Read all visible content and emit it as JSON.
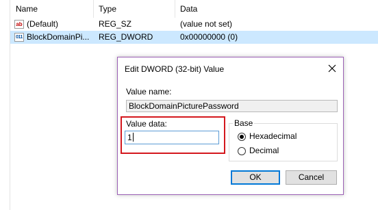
{
  "columns": {
    "name": "Name",
    "type": "Type",
    "data": "Data"
  },
  "rows": [
    {
      "icon": "string-value-icon",
      "icon_glyph": "ab",
      "name": "(Default)",
      "type": "REG_SZ",
      "data": "(value not set)"
    },
    {
      "icon": "binary-value-icon",
      "icon_glyph": "011",
      "name": "BlockDomainPi...",
      "type": "REG_DWORD",
      "data": "0x00000000 (0)"
    }
  ],
  "dialog": {
    "title": "Edit DWORD (32-bit) Value",
    "close_label": "close-icon",
    "value_name_label": "Value name:",
    "value_name": "BlockDomainPicturePassword",
    "value_data_label": "Value data:",
    "value_data": "1",
    "base_label": "Base",
    "base_options": [
      "Hexadecimal",
      "Decimal"
    ],
    "base_selected": "Hexadecimal",
    "ok_label": "OK",
    "cancel_label": "Cancel"
  },
  "colors": {
    "selection": "#cce8ff",
    "dialog_border": "#9b5fb5",
    "highlight_box": "#d4161c",
    "default_button": "#0078d7"
  }
}
